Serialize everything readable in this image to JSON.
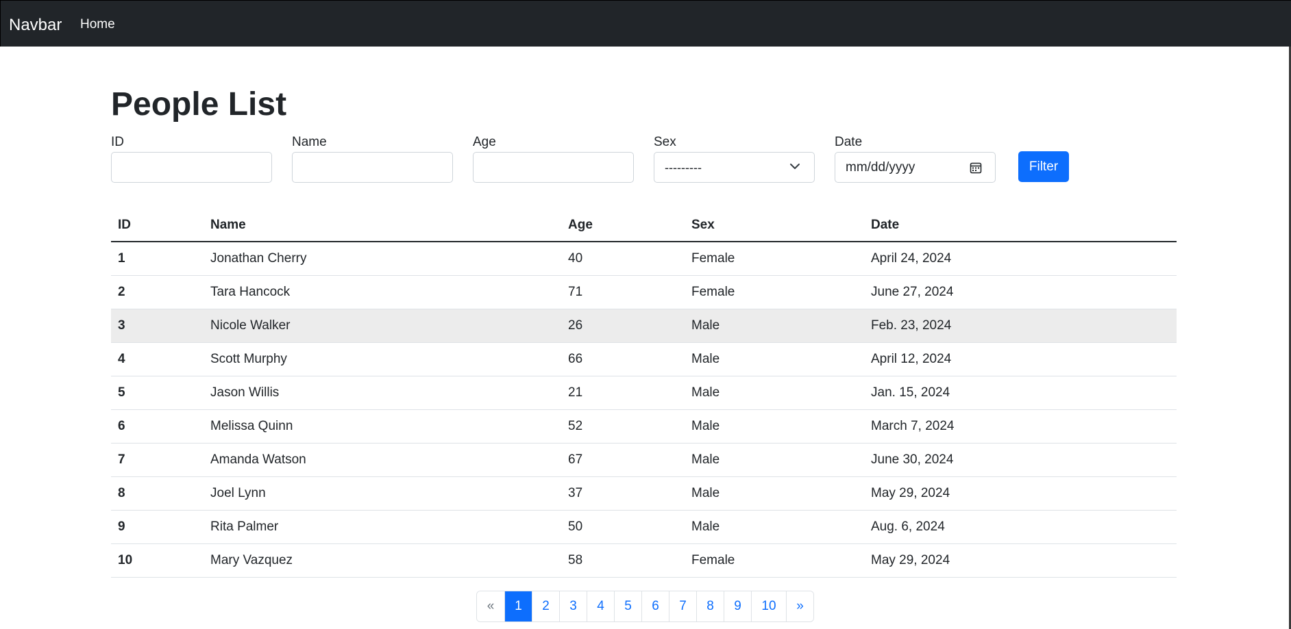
{
  "navbar": {
    "brand": "Navbar",
    "home": "Home"
  },
  "page": {
    "title": "People List"
  },
  "filters": {
    "id_label": "ID",
    "id_value": "",
    "name_label": "Name",
    "name_value": "",
    "age_label": "Age",
    "age_value": "",
    "sex_label": "Sex",
    "sex_value": "---------",
    "date_label": "Date",
    "date_placeholder": "mm/dd/yyyy",
    "filter_button": "Filter"
  },
  "table": {
    "headers": [
      "ID",
      "Name",
      "Age",
      "Sex",
      "Date"
    ],
    "rows": [
      {
        "id": "1",
        "name": "Jonathan Cherry",
        "age": "40",
        "sex": "Female",
        "date": "April 24, 2024"
      },
      {
        "id": "2",
        "name": "Tara Hancock",
        "age": "71",
        "sex": "Female",
        "date": "June 27, 2024"
      },
      {
        "id": "3",
        "name": "Nicole Walker",
        "age": "26",
        "sex": "Male",
        "date": "Feb. 23, 2024"
      },
      {
        "id": "4",
        "name": "Scott Murphy",
        "age": "66",
        "sex": "Male",
        "date": "April 12, 2024"
      },
      {
        "id": "5",
        "name": "Jason Willis",
        "age": "21",
        "sex": "Male",
        "date": "Jan. 15, 2024"
      },
      {
        "id": "6",
        "name": "Melissa Quinn",
        "age": "52",
        "sex": "Male",
        "date": "March 7, 2024"
      },
      {
        "id": "7",
        "name": "Amanda Watson",
        "age": "67",
        "sex": "Male",
        "date": "June 30, 2024"
      },
      {
        "id": "8",
        "name": "Joel Lynn",
        "age": "37",
        "sex": "Male",
        "date": "May 29, 2024"
      },
      {
        "id": "9",
        "name": "Rita Palmer",
        "age": "50",
        "sex": "Male",
        "date": "Aug. 6, 2024"
      },
      {
        "id": "10",
        "name": "Mary Vazquez",
        "age": "58",
        "sex": "Female",
        "date": "May 29, 2024"
      }
    ]
  },
  "pagination": {
    "prev": "«",
    "pages": [
      "1",
      "2",
      "3",
      "4",
      "5",
      "6",
      "7",
      "8",
      "9",
      "10"
    ],
    "next": "»",
    "current": "1"
  },
  "colors": {
    "navbar_bg": "#212529",
    "primary": "#0d6efd",
    "hover_row": "#ececec"
  }
}
